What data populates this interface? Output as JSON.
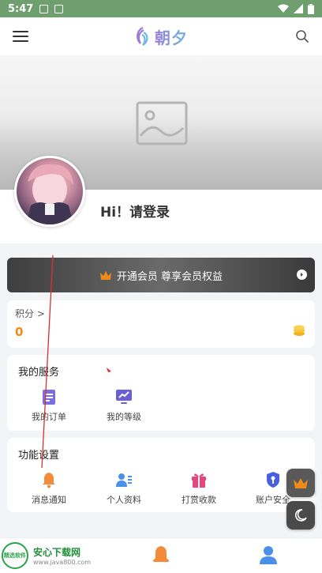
{
  "status": {
    "time": "5:47"
  },
  "header": {
    "logo_text": "朝夕",
    "menu_icon": "menu-icon",
    "search_icon": "search-icon"
  },
  "profile": {
    "greeting": "Hi！请登录"
  },
  "vip": {
    "label": "开通会员 尊享会员权益"
  },
  "points": {
    "label": "积分 >",
    "value": "0"
  },
  "services": {
    "title": "我的服务",
    "items": [
      {
        "label": "我的订单",
        "icon": "order-icon",
        "color": "#7b6fe0"
      },
      {
        "label": "我的等级",
        "icon": "level-icon",
        "color": "#6a5fd6"
      }
    ]
  },
  "features": {
    "title": "功能设置",
    "items": [
      {
        "label": "消息通知",
        "icon": "bell-icon",
        "color": "#f28b3a"
      },
      {
        "label": "个人资料",
        "icon": "profile-icon",
        "color": "#4a8fe8"
      },
      {
        "label": "打赏收款",
        "icon": "gift-icon",
        "color": "#e8457a"
      },
      {
        "label": "账户安全",
        "icon": "shield-icon",
        "color": "#4a5fe0"
      }
    ]
  },
  "watermark": {
    "title": "安心下载网",
    "url": "www.java800.com",
    "badge": "精选软件"
  },
  "colors": {
    "accent_orange": "#f08a1a",
    "statusbar": "#6f9e6f"
  }
}
